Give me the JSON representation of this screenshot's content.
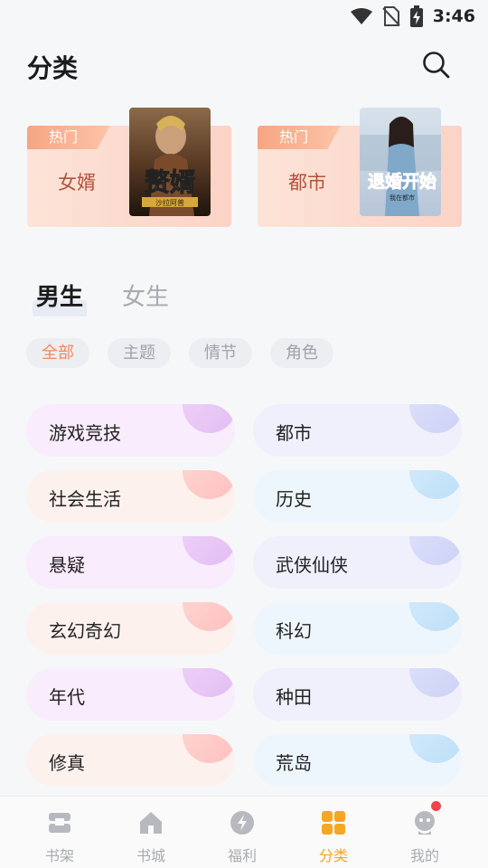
{
  "status_bar": {
    "time": "3:46",
    "icons": [
      "wifi-icon",
      "no-sim-icon",
      "battery-charging-icon"
    ]
  },
  "header": {
    "title": "分类",
    "search_icon": "search-icon"
  },
  "hot_cards": [
    {
      "tag": "热门",
      "name": "女婿",
      "cover_title": "赘婿",
      "cover_sub": "沙拉阿普"
    },
    {
      "tag": "热门",
      "name": "都市",
      "cover_title": "退婚开始",
      "cover_sub": "我在都市"
    }
  ],
  "gender_tabs": [
    {
      "label": "男生",
      "active": true
    },
    {
      "label": "女生",
      "active": false
    }
  ],
  "filter_chips": [
    {
      "label": "全部",
      "active": true
    },
    {
      "label": "主题",
      "active": false
    },
    {
      "label": "情节",
      "active": false
    },
    {
      "label": "角色",
      "active": false
    }
  ],
  "categories": [
    {
      "label": "游戏竞技",
      "style": "purple"
    },
    {
      "label": "都市",
      "style": "lavender"
    },
    {
      "label": "社会生活",
      "style": "pink"
    },
    {
      "label": "历史",
      "style": "sky"
    },
    {
      "label": "悬疑",
      "style": "purple"
    },
    {
      "label": "武侠仙侠",
      "style": "lavender"
    },
    {
      "label": "玄幻奇幻",
      "style": "pink"
    },
    {
      "label": "科幻",
      "style": "sky"
    },
    {
      "label": "年代",
      "style": "purple"
    },
    {
      "label": "种田",
      "style": "lavender"
    },
    {
      "label": "修真",
      "style": "pink"
    },
    {
      "label": "荒岛",
      "style": "sky"
    }
  ],
  "bottom_nav": [
    {
      "label": "书架",
      "icon": "bookshelf-icon",
      "active": false
    },
    {
      "label": "书城",
      "icon": "home-icon",
      "active": false
    },
    {
      "label": "福利",
      "icon": "lightning-icon",
      "active": false
    },
    {
      "label": "分类",
      "icon": "grid-icon",
      "active": true
    },
    {
      "label": "我的",
      "icon": "profile-icon",
      "active": false,
      "badge": true
    }
  ],
  "colors": {
    "accent": "#f5a622",
    "chip_active": "#f08a5d",
    "badge": "#f0444a"
  }
}
